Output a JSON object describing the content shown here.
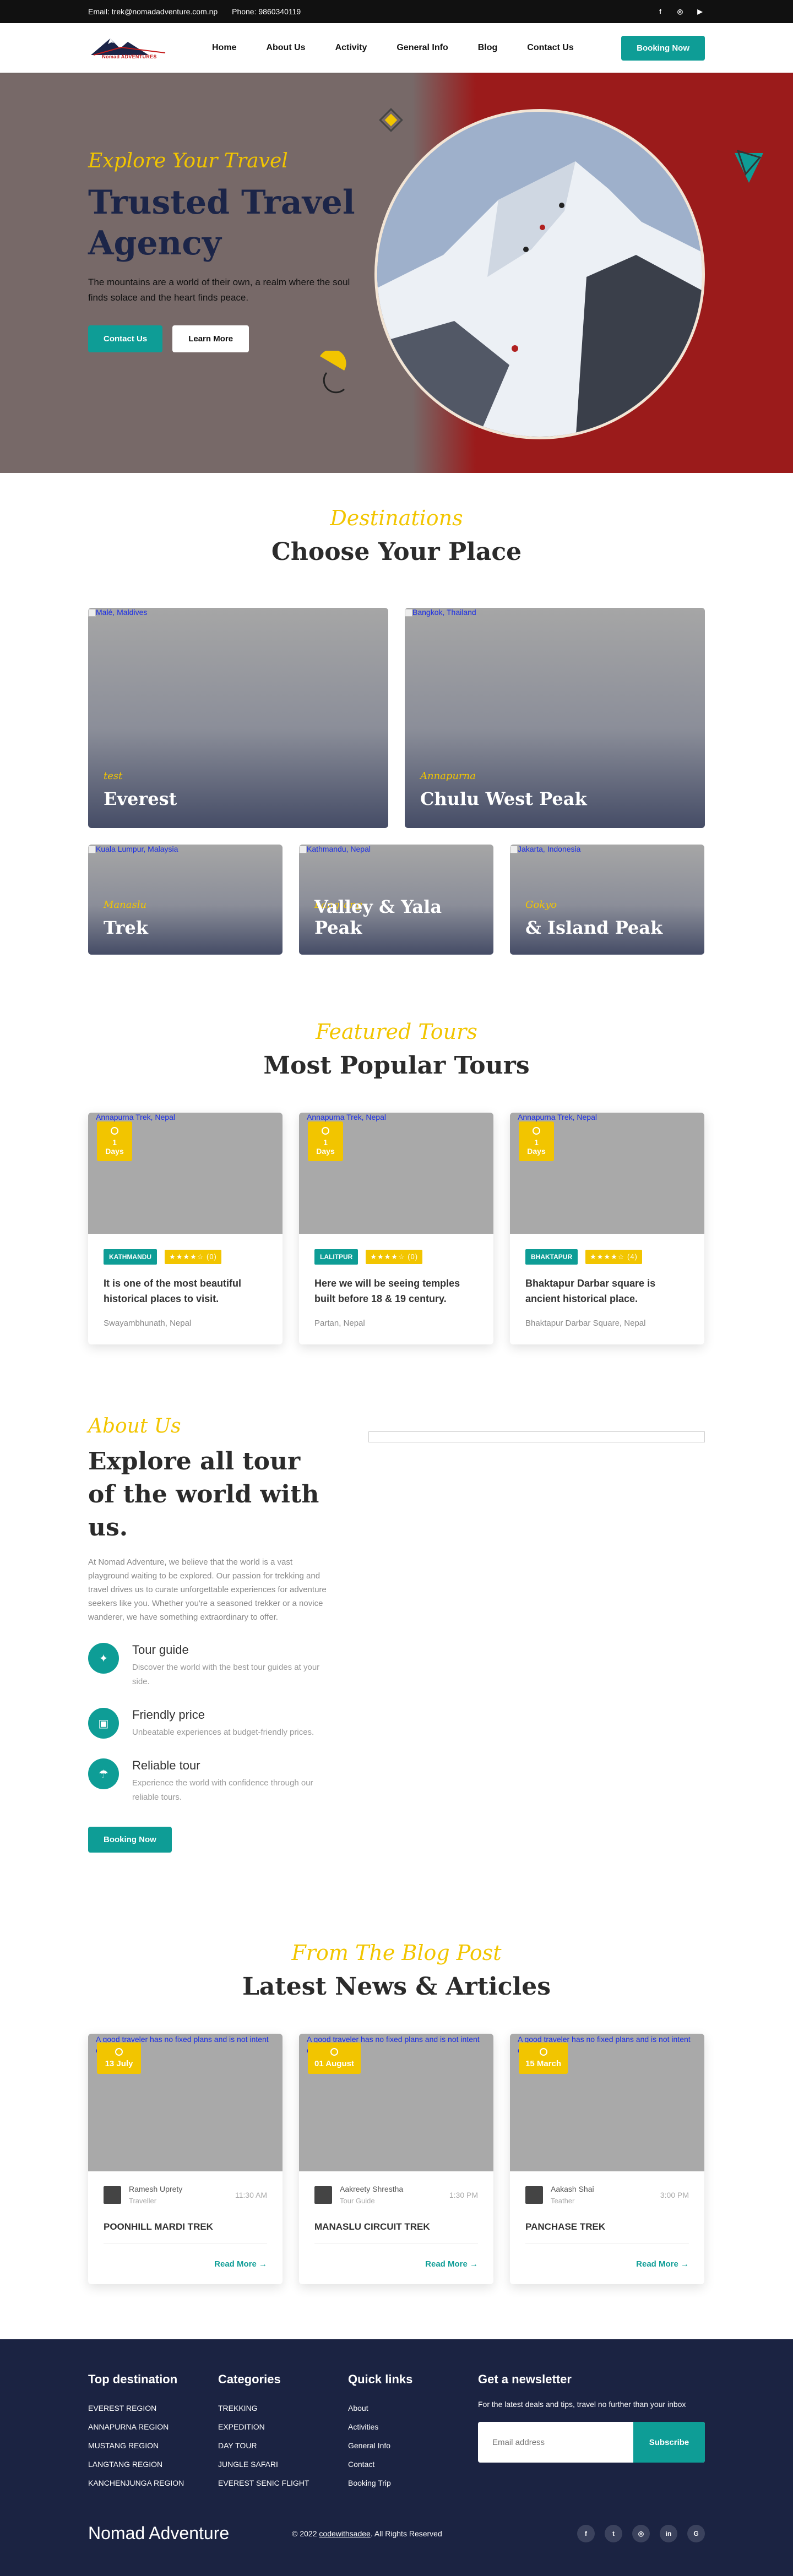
{
  "topbar": {
    "email": "Email: trek@nomadadventure.com.np",
    "phone": "Phone: 9860340119",
    "socials": [
      "facebook-icon",
      "instagram-icon",
      "youtube-icon"
    ]
  },
  "nav": {
    "logo_text": "Nomad ADVENTURES",
    "links": [
      "Home",
      "About Us",
      "Activity",
      "General Info",
      "Blog",
      "Contact Us"
    ],
    "cta": "Booking Now"
  },
  "hero": {
    "script": "Explore Your Travel",
    "title": "Trusted Travel Agency",
    "desc": "The mountains are a world of their own, a realm where the soul finds solace and the heart finds peace.",
    "btn_contact": "Contact Us",
    "btn_learn": "Learn More"
  },
  "destinations": {
    "script": "Destinations",
    "title": "Choose Your Place",
    "cards": [
      {
        "alt": "Malé, Maldives",
        "sub": "test",
        "name": "Everest"
      },
      {
        "alt": "Bangkok, Thailand",
        "sub": "Annapurna",
        "name": "Chulu West Peak"
      },
      {
        "alt": "Kuala Lumpur, Malaysia",
        "sub": "Manaslu",
        "name": "Trek"
      },
      {
        "alt": "Kathmandu, Nepal",
        "sub": "Langtang",
        "name": "Valley & Yala Peak"
      },
      {
        "alt": "Jakarta, Indonesia",
        "sub": "Gokyo",
        "name": "& Island Peak"
      }
    ]
  },
  "tours": {
    "script": "Featured Tours",
    "title": "Most Popular Tours",
    "cards": [
      {
        "alt": "Annapurna Trek, Nepal",
        "days": "1 Days",
        "tag": "KATHMANDU",
        "stars": "★★★★☆ (0)",
        "title": "It is one of the most beautiful historical places to visit.",
        "loc": "Swayambhunath, Nepal"
      },
      {
        "alt": "Annapurna Trek, Nepal",
        "days": "1 Days",
        "tag": "LALITPUR",
        "stars": "★★★★☆ (0)",
        "title": "Here we will be seeing temples built before 18 & 19 century.",
        "loc": "Partan, Nepal"
      },
      {
        "alt": "Annapurna Trek, Nepal",
        "days": "1 Days",
        "tag": "BHAKTAPUR",
        "stars": "★★★★☆ (4)",
        "title": "Bhaktapur Darbar square is ancient historical place.",
        "loc": "Bhaktapur Darbar Square, Nepal"
      }
    ]
  },
  "about": {
    "script": "About Us",
    "title": "Explore all tour of the world with us.",
    "desc": "At Nomad Adventure, we believe that the world is a vast playground waiting to be explored. Our passion for trekking and travel drives us to curate unforgettable experiences for adventure seekers like you. Whether you're a seasoned trekker or a novice wanderer, we have something extraordinary to offer.",
    "features": [
      {
        "icon": "compass-icon",
        "title": "Tour guide",
        "desc": "Discover the world with the best tour guides at your side."
      },
      {
        "icon": "wallet-icon",
        "title": "Friendly price",
        "desc": "Unbeatable experiences at budget-friendly prices."
      },
      {
        "icon": "umbrella-icon",
        "title": "Reliable tour",
        "desc": "Experience the world with confidence through our reliable tours."
      }
    ],
    "btn": "Booking Now"
  },
  "blog": {
    "script": "From The Blog Post",
    "title": "Latest News & Articles",
    "cards": [
      {
        "alt": "A good traveler has no fixed plans and is not intent on arriving",
        "date": "13 July",
        "author": "Ramesh Uprety",
        "role": "Traveller",
        "time": "11:30 AM",
        "title": "POONHILL MARDI TREK",
        "read": "Read More →"
      },
      {
        "alt": "A good traveler has no fixed plans and is not intent on arriving",
        "date": "01 August",
        "author": "Aakreety Shrestha",
        "role": "Tour Guide",
        "time": "1:30 PM",
        "title": "MANASLU CIRCUIT TREK",
        "read": "Read More →"
      },
      {
        "alt": "A good traveler has no fixed plans and is not intent on arriving",
        "date": "15 March",
        "author": "Aakash Shai",
        "role": "Teather",
        "time": "3:00 PM",
        "title": "PANCHASE TREK",
        "read": "Read More →"
      }
    ]
  },
  "footer": {
    "cols": [
      {
        "title": "Top destination",
        "items": [
          "EVEREST REGION",
          "ANNAPURNA REGION",
          "MUSTANG REGION",
          "LANGTANG REGION",
          "KANCHENJUNGA REGION"
        ]
      },
      {
        "title": "Categories",
        "items": [
          "TREKKING",
          "EXPEDITION",
          "DAY TOUR",
          "JUNGLE SAFARI",
          "EVEREST SENIC FLIGHT"
        ]
      },
      {
        "title": "Quick links",
        "items": [
          "About",
          "Activities",
          "General Info",
          "Contact",
          "Booking Trip"
        ]
      }
    ],
    "newsletter_title": "Get a newsletter",
    "newsletter_desc": "For the latest deals and tips, travel no further than your inbox",
    "email_placeholder": "Email address",
    "subscribe": "Subscribe",
    "brand": "Nomad Adventure",
    "copyright_pre": "© 2022 ",
    "copyright_link": "codewithsadee",
    "copyright_post": ". All Rights Reserved",
    "socials": [
      "facebook-icon",
      "twitter-icon",
      "instagram-icon",
      "linkedin-icon",
      "google-icon"
    ]
  },
  "colors": {
    "teal": "#0e9d96",
    "yellow": "#f2c500",
    "navy": "#1b2342",
    "hero_red": "#9b1b1b"
  }
}
